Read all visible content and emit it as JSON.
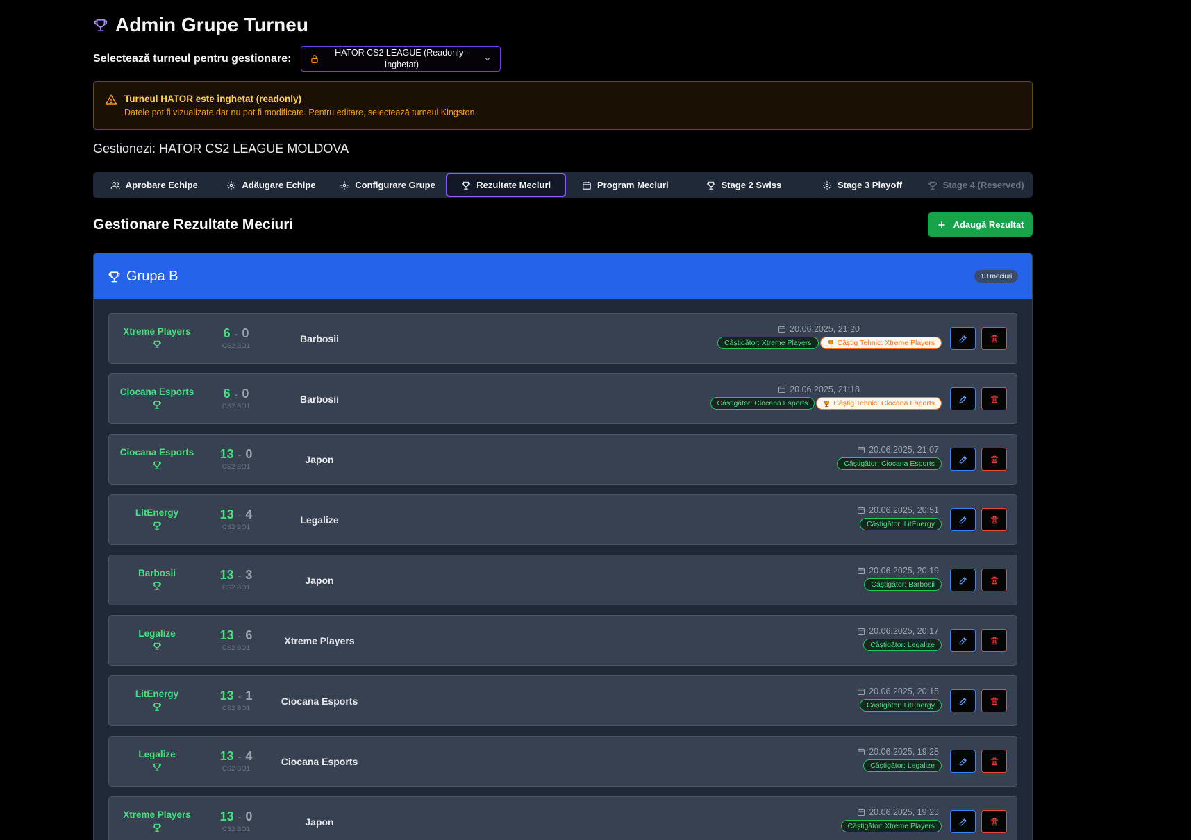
{
  "page": {
    "title": "Admin Grupe Turneu",
    "select_label": "Selectează turneul pentru gestionare:",
    "select_value_line1": "HATOR CS2 LEAGUE (Readonly -",
    "select_value_line2": "Înghețat)",
    "alert_title": "Turneul HATOR este înghețat (readonly)",
    "alert_desc": "Datele pot fi vizualizate dar nu pot fi modificate. Pentru editare, selectează turneul Kingston.",
    "managing": "Gestionezi: HATOR CS2 LEAGUE MOLDOVA",
    "section_title": "Gestionare Rezultate Meciuri",
    "add_button": "Adaugă Rezultat"
  },
  "tabs": [
    {
      "label": "Aprobare Echipe",
      "icon": "users-icon"
    },
    {
      "label": "Adăugare Echipe",
      "icon": "gear-icon"
    },
    {
      "label": "Configurare Grupe",
      "icon": "gear-icon"
    },
    {
      "label": "Rezultate Meciuri",
      "icon": "trophy-icon",
      "active": true
    },
    {
      "label": "Program Meciuri",
      "icon": "calendar-icon"
    },
    {
      "label": "Stage 2 Swiss",
      "icon": "trophy-icon"
    },
    {
      "label": "Stage 3 Playoff",
      "icon": "gear-icon"
    },
    {
      "label": "Stage 4 (Reserved)",
      "icon": "trophy-icon",
      "disabled": true
    }
  ],
  "group": {
    "name": "Grupa B",
    "count": "13 meciuri"
  },
  "matches": [
    {
      "team1": "Xtreme Players",
      "score1": "6",
      "score2": "0",
      "format": "CS2 BO1",
      "team2": "Barbosii",
      "date": "20.06.2025, 21:20",
      "winner": "Câștigător: Xtreme Players",
      "tech": "Câștig Tehnic: Xtreme Players"
    },
    {
      "team1": "Ciocana Esports",
      "score1": "6",
      "score2": "0",
      "format": "CS2 BO1",
      "team2": "Barbosii",
      "date": "20.06.2025, 21:18",
      "winner": "Câștigător: Ciocana Esports",
      "tech": "Câștig Tehnic: Ciocana Esports"
    },
    {
      "team1": "Ciocana Esports",
      "score1": "13",
      "score2": "0",
      "format": "CS2 BO1",
      "team2": "Japon",
      "date": "20.06.2025, 21:07",
      "winner": "Câștigător: Ciocana Esports"
    },
    {
      "team1": "LitEnergy",
      "score1": "13",
      "score2": "4",
      "format": "CS2 BO1",
      "team2": "Legalize",
      "date": "20.06.2025, 20:51",
      "winner": "Câștigător: LitEnergy"
    },
    {
      "team1": "Barbosii",
      "score1": "13",
      "score2": "3",
      "format": "CS2 BO1",
      "team2": "Japon",
      "date": "20.06.2025, 20:19",
      "winner": "Câștigător: Barbosii"
    },
    {
      "team1": "Legalize",
      "score1": "13",
      "score2": "6",
      "format": "CS2 BO1",
      "team2": "Xtreme Players",
      "date": "20.06.2025, 20:17",
      "winner": "Câștigător: Legalize"
    },
    {
      "team1": "LitEnergy",
      "score1": "13",
      "score2": "1",
      "format": "CS2 BO1",
      "team2": "Ciocana Esports",
      "date": "20.06.2025, 20:15",
      "winner": "Câștigător: LitEnergy"
    },
    {
      "team1": "Legalize",
      "score1": "13",
      "score2": "4",
      "format": "CS2 BO1",
      "team2": "Ciocana Esports",
      "date": "20.06.2025, 19:28",
      "winner": "Câștigător: Legalize"
    },
    {
      "team1": "Xtreme Players",
      "score1": "13",
      "score2": "0",
      "format": "CS2 BO1",
      "team2": "Japon",
      "date": "20.06.2025, 19:23",
      "winner": "Câștigător: Xtreme Players"
    }
  ],
  "colors": {
    "accent_purple": "#8b5cf6",
    "group_header": "#2563eb",
    "win_green": "#4ade80",
    "add_button": "#16a34a",
    "warning": "#fcd34d"
  }
}
